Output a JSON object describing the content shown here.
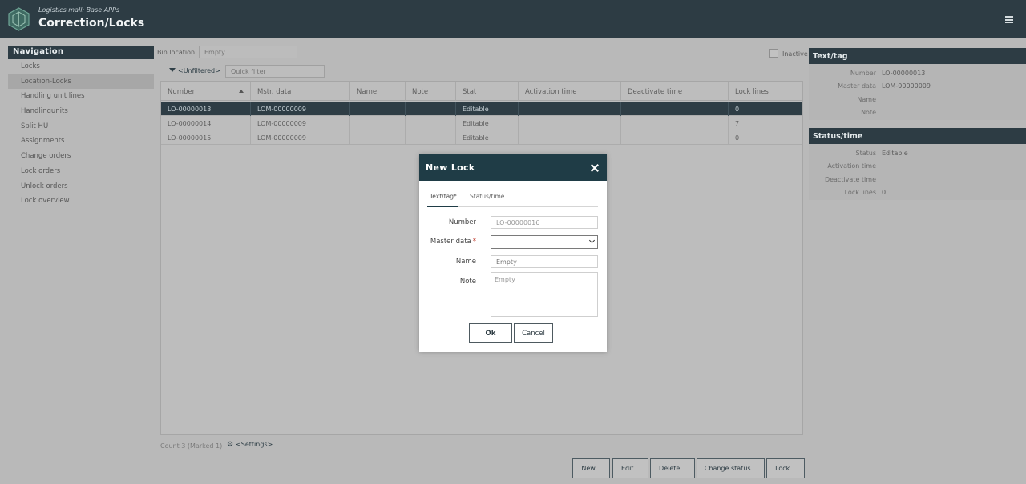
{
  "header": {
    "subtitle": "Logistics mall: Base APPs",
    "title": "Correction/Locks"
  },
  "navigation": {
    "heading": "Navigation",
    "items": [
      "Locks",
      "Location-Locks",
      "Handling unit lines",
      "Handlingunits",
      "Split HU",
      "Assignments",
      "Change orders",
      "Lock orders",
      "Unlock orders",
      "Lock overview"
    ],
    "active_index": 1
  },
  "filters": {
    "bin_location_label": "Bin location",
    "bin_location_placeholder": "Empty",
    "inactive_label": "Inactive",
    "filter_tag": "<Unfiltered>",
    "quick_filter_placeholder": "Quick filter"
  },
  "grid": {
    "columns": [
      "Number",
      "Mstr. data",
      "Name",
      "Note",
      "Stat",
      "Activation time",
      "Deactivate time",
      "Lock lines"
    ],
    "sorted_column": "Number",
    "rows": [
      [
        "LO-00000013",
        "LOM-00000009",
        "",
        "",
        "Editable",
        "",
        "",
        "0"
      ],
      [
        "LO-00000014",
        "LOM-00000009",
        "",
        "",
        "Editable",
        "",
        "",
        "7"
      ],
      [
        "LO-00000015",
        "LOM-00000009",
        "",
        "",
        "Editable",
        "",
        "",
        "0"
      ]
    ],
    "selected_row": 0
  },
  "footer": {
    "count_text": "Count 3 (Marked 1)",
    "settings_label": "<Settings>"
  },
  "actions": {
    "new": "New...",
    "edit": "Edit...",
    "delete": "Delete...",
    "change_status": "Change status...",
    "lock": "Lock..."
  },
  "detail": {
    "text_tag": {
      "heading": "Text/tag",
      "number_label": "Number",
      "number_value": "LO-00000013",
      "master_label": "Master data",
      "master_value": "LOM-00000009",
      "name_label": "Name",
      "note_label": "Note"
    },
    "status_time": {
      "heading": "Status/time",
      "status_label": "Status",
      "status_value": "Editable",
      "activation_label": "Activation time",
      "deactivate_label": "Deactivate time",
      "lock_lines_label": "Lock lines",
      "lock_lines_value": "0"
    }
  },
  "dialog": {
    "title": "New Lock",
    "tabs": [
      "Text/tag*",
      "Status/time"
    ],
    "active_tab": 0,
    "number_label": "Number",
    "number_value": "LO-00000016",
    "master_label": "Master data",
    "master_required": "*",
    "master_value": "",
    "name_label": "Name",
    "name_placeholder": "Empty",
    "note_label": "Note",
    "note_placeholder": "Empty",
    "ok_label": "Ok",
    "cancel_label": "Cancel"
  },
  "colors": {
    "header_bg": "#2d3c44",
    "dialog_title_bg": "#1f3c46",
    "selected_row_bg": "#2e3d45",
    "overlay_bg": "#b9b9b9"
  }
}
